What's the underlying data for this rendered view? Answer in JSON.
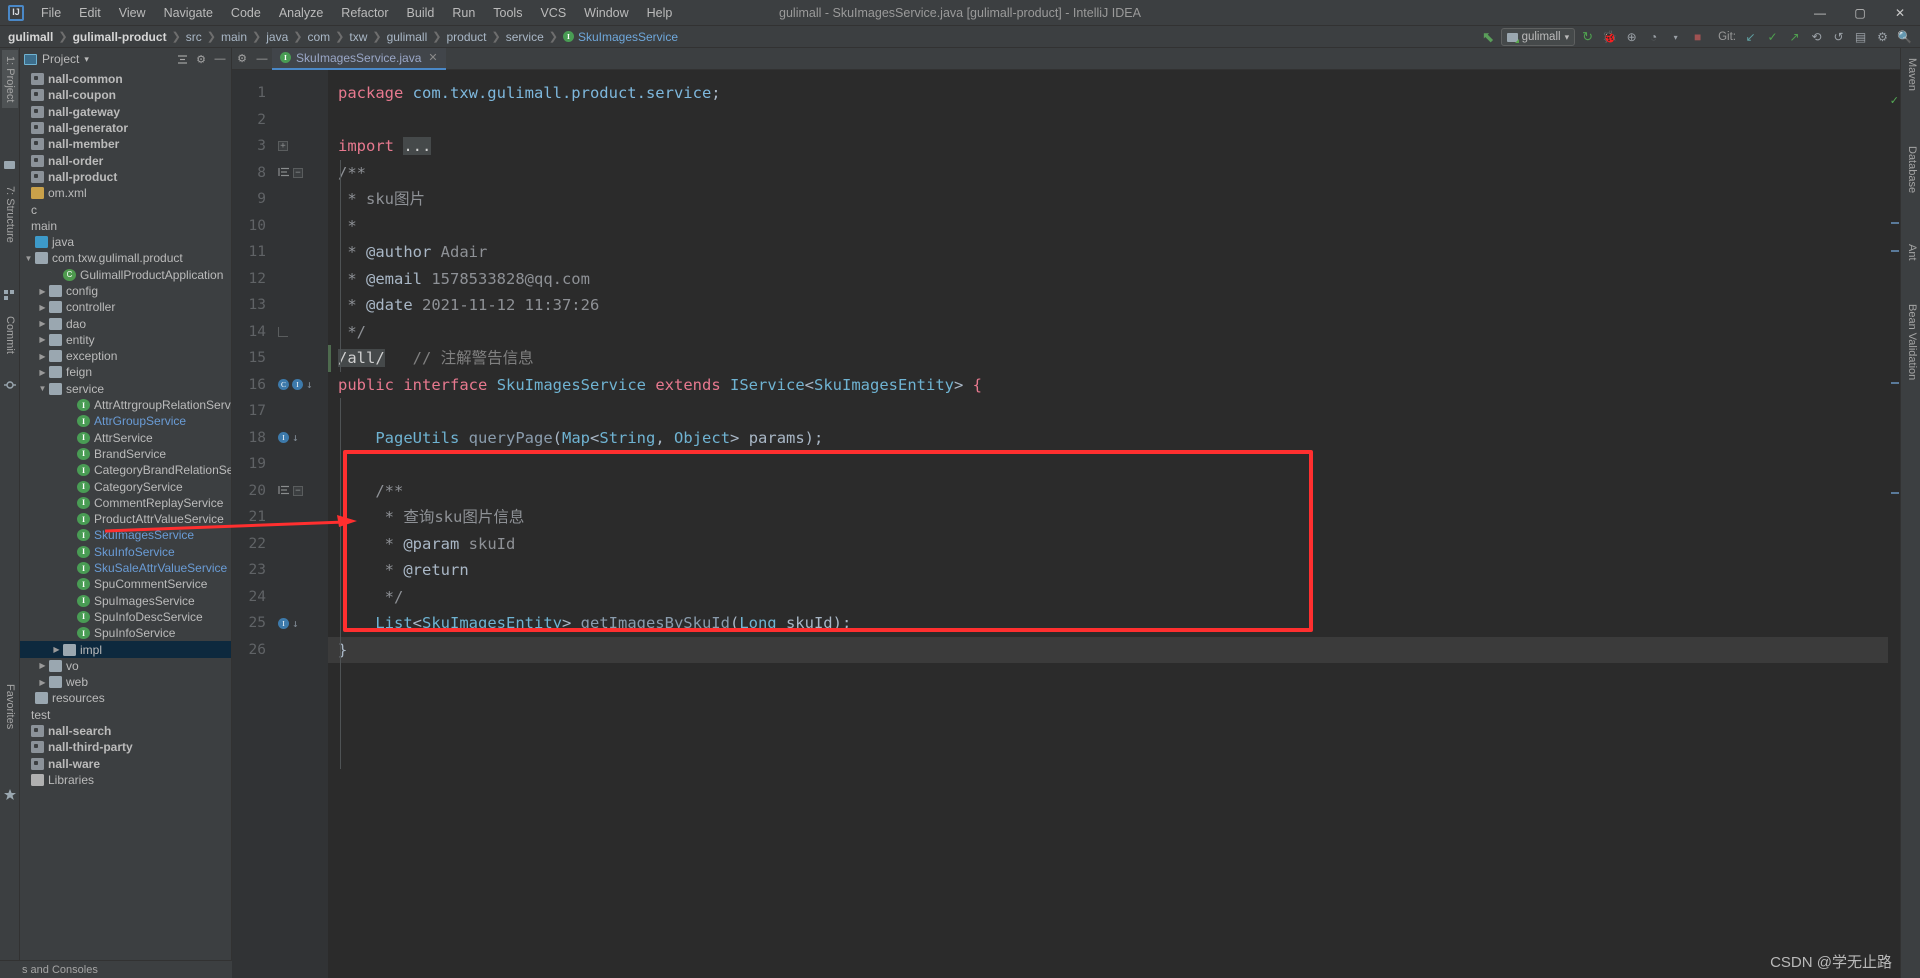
{
  "window": {
    "title": "gulimall - SkuImagesService.java [gulimall-product] - IntelliJ IDEA",
    "logo": "IJ",
    "minimize": "—",
    "maximize": "▢",
    "close": "✕"
  },
  "menu": [
    {
      "label": "File"
    },
    {
      "label": "Edit"
    },
    {
      "label": "View"
    },
    {
      "label": "Navigate"
    },
    {
      "label": "Code"
    },
    {
      "label": "Analyze"
    },
    {
      "label": "Refactor"
    },
    {
      "label": "Build"
    },
    {
      "label": "Run"
    },
    {
      "label": "Tools"
    },
    {
      "label": "VCS"
    },
    {
      "label": "Window"
    },
    {
      "label": "Help"
    }
  ],
  "breadcrumb": [
    {
      "label": "gulimall",
      "style": "bold"
    },
    {
      "label": "gulimall-product",
      "style": "bold"
    },
    {
      "label": "src",
      "style": "normal"
    },
    {
      "label": "main",
      "style": "normal"
    },
    {
      "label": "java",
      "style": "normal"
    },
    {
      "label": "com",
      "style": "normal"
    },
    {
      "label": "txw",
      "style": "normal"
    },
    {
      "label": "gulimall",
      "style": "normal"
    },
    {
      "label": "product",
      "style": "normal"
    },
    {
      "label": "service",
      "style": "normal"
    },
    {
      "label": "SkuImagesService",
      "style": "interface"
    }
  ],
  "toolbar": {
    "build_icon": "build-hammer-icon",
    "run_config": "gulimall",
    "dropdown_caret": "▾",
    "run_icon": "▶",
    "debug_icon": "debug-icon",
    "coverage_icon": "coverage-icon",
    "profiler_icon": "profiler-icon",
    "stop_icon": "■",
    "git_label": "Git:",
    "git_update": "↙",
    "git_commit": "✓",
    "git_push": "↗",
    "git_history": "⟲",
    "search_icon": "🔍",
    "layout_icon": "layout-icon",
    "settings_icon": "⚙",
    "avatar_icon": "avatar-icon"
  },
  "left_stripe": [
    {
      "label": "1: Project",
      "active": true
    },
    {
      "label": "7: Structure",
      "active": false
    },
    {
      "label": "Commit",
      "active": false
    },
    {
      "label": "Favorites",
      "active": false
    }
  ],
  "right_stripe": [
    {
      "label": "Maven"
    },
    {
      "label": "Database"
    },
    {
      "label": "Ant"
    },
    {
      "label": "Bean Validation"
    }
  ],
  "bottom_stripe": {
    "label": "s and Consoles"
  },
  "project_panel": {
    "title": "Project",
    "title_caret": "▾",
    "collapse_icon": "collapse-all-icon",
    "settings_icon": "⚙",
    "hide_icon": "—",
    "tree": [
      {
        "label": "nall-common",
        "indent": 0,
        "arrow": "",
        "icon": "mod",
        "color": "bold",
        "selected": false
      },
      {
        "label": "nall-coupon",
        "indent": 0,
        "arrow": "",
        "icon": "mod",
        "color": "bold",
        "selected": false
      },
      {
        "label": "nall-gateway",
        "indent": 0,
        "arrow": "",
        "icon": "mod",
        "color": "bold",
        "selected": false
      },
      {
        "label": "nall-generator",
        "indent": 0,
        "arrow": "",
        "icon": "mod",
        "color": "bold",
        "selected": false
      },
      {
        "label": "nall-member",
        "indent": 0,
        "arrow": "",
        "icon": "mod",
        "color": "bold",
        "selected": false
      },
      {
        "label": "nall-order",
        "indent": 0,
        "arrow": "",
        "icon": "mod",
        "color": "bold",
        "selected": false
      },
      {
        "label": "nall-product",
        "indent": 0,
        "arrow": "",
        "icon": "mod",
        "color": "bold",
        "selected": false
      },
      {
        "label": "om.xml",
        "indent": 0,
        "arrow": "",
        "icon": "xml",
        "color": "normal",
        "selected": false
      },
      {
        "label": "c",
        "indent": 0,
        "arrow": "",
        "icon": "none",
        "color": "normal",
        "selected": false
      },
      {
        "label": "main",
        "indent": 0,
        "arrow": "",
        "icon": "none",
        "color": "normal",
        "selected": false
      },
      {
        "label": "java",
        "indent": 1,
        "arrow": "",
        "icon": "src",
        "color": "normal",
        "selected": false
      },
      {
        "label": "com.txw.gulimall.product",
        "indent": 1,
        "arrow": "▼",
        "icon": "fld",
        "color": "normal",
        "selected": false
      },
      {
        "label": "GulimallProductApplication",
        "indent": 3,
        "arrow": "",
        "icon": "cls",
        "color": "normal",
        "selected": false
      },
      {
        "label": "config",
        "indent": 2,
        "arrow": "▶",
        "icon": "fld",
        "color": "normal",
        "selected": false
      },
      {
        "label": "controller",
        "indent": 2,
        "arrow": "▶",
        "icon": "fld",
        "color": "normal",
        "selected": false
      },
      {
        "label": "dao",
        "indent": 2,
        "arrow": "▶",
        "icon": "fld",
        "color": "normal",
        "selected": false
      },
      {
        "label": "entity",
        "indent": 2,
        "arrow": "▶",
        "icon": "fld",
        "color": "normal",
        "selected": false
      },
      {
        "label": "exception",
        "indent": 2,
        "arrow": "▶",
        "icon": "fld",
        "color": "normal",
        "selected": false
      },
      {
        "label": "feign",
        "indent": 2,
        "arrow": "▶",
        "icon": "fld",
        "color": "normal",
        "selected": false
      },
      {
        "label": "service",
        "indent": 2,
        "arrow": "▼",
        "icon": "fld",
        "color": "normal",
        "selected": false
      },
      {
        "label": "AttrAttrgroupRelationService",
        "indent": 4,
        "arrow": "",
        "icon": "iface",
        "color": "normal",
        "selected": false
      },
      {
        "label": "AttrGroupService",
        "indent": 4,
        "arrow": "",
        "icon": "iface",
        "color": "blue",
        "selected": false
      },
      {
        "label": "AttrService",
        "indent": 4,
        "arrow": "",
        "icon": "iface",
        "color": "normal",
        "selected": false
      },
      {
        "label": "BrandService",
        "indent": 4,
        "arrow": "",
        "icon": "iface",
        "color": "normal",
        "selected": false
      },
      {
        "label": "CategoryBrandRelationService",
        "indent": 4,
        "arrow": "",
        "icon": "iface",
        "color": "normal",
        "selected": false
      },
      {
        "label": "CategoryService",
        "indent": 4,
        "arrow": "",
        "icon": "iface",
        "color": "normal",
        "selected": false
      },
      {
        "label": "CommentReplayService",
        "indent": 4,
        "arrow": "",
        "icon": "iface",
        "color": "normal",
        "selected": false
      },
      {
        "label": "ProductAttrValueService",
        "indent": 4,
        "arrow": "",
        "icon": "iface",
        "color": "normal",
        "selected": false
      },
      {
        "label": "SkuImagesService",
        "indent": 4,
        "arrow": "",
        "icon": "iface",
        "color": "blue",
        "selected": false
      },
      {
        "label": "SkuInfoService",
        "indent": 4,
        "arrow": "",
        "icon": "iface",
        "color": "blue",
        "selected": false
      },
      {
        "label": "SkuSaleAttrValueService",
        "indent": 4,
        "arrow": "",
        "icon": "iface",
        "color": "blue",
        "selected": false
      },
      {
        "label": "SpuCommentService",
        "indent": 4,
        "arrow": "",
        "icon": "iface",
        "color": "normal",
        "selected": false
      },
      {
        "label": "SpuImagesService",
        "indent": 4,
        "arrow": "",
        "icon": "iface",
        "color": "normal",
        "selected": false
      },
      {
        "label": "SpuInfoDescService",
        "indent": 4,
        "arrow": "",
        "icon": "iface",
        "color": "normal",
        "selected": false
      },
      {
        "label": "SpuInfoService",
        "indent": 4,
        "arrow": "",
        "icon": "iface",
        "color": "normal",
        "selected": false
      },
      {
        "label": "impl",
        "indent": 3,
        "arrow": "▶",
        "icon": "fld",
        "color": "normal",
        "selected": true
      },
      {
        "label": "vo",
        "indent": 2,
        "arrow": "▶",
        "icon": "fld",
        "color": "normal",
        "selected": false
      },
      {
        "label": "web",
        "indent": 2,
        "arrow": "▶",
        "icon": "fld",
        "color": "normal",
        "selected": false
      },
      {
        "label": "resources",
        "indent": 1,
        "arrow": "",
        "icon": "fld",
        "color": "normal",
        "selected": false
      },
      {
        "label": "test",
        "indent": 0,
        "arrow": "",
        "icon": "none",
        "color": "normal",
        "selected": false
      },
      {
        "label": "nall-search",
        "indent": 0,
        "arrow": "",
        "icon": "mod",
        "color": "bold",
        "selected": false
      },
      {
        "label": "nall-third-party",
        "indent": 0,
        "arrow": "",
        "icon": "mod",
        "color": "bold",
        "selected": false
      },
      {
        "label": "nall-ware",
        "indent": 0,
        "arrow": "",
        "icon": "mod",
        "color": "bold",
        "selected": false
      },
      {
        "label": "Libraries",
        "indent": 0,
        "arrow": "",
        "icon": "lib",
        "color": "normal",
        "selected": false
      }
    ]
  },
  "editor": {
    "tab": {
      "label": "SkuImagesService.java",
      "icon": "interface-icon",
      "close": "✕"
    },
    "settings_icon": "⚙",
    "hide_icon": "—",
    "lines": [
      {
        "num": "1",
        "tokens": [
          {
            "t": "package ",
            "c": "kw2"
          },
          {
            "t": "com.txw.gulimall.product.service",
            "c": "pkg"
          },
          {
            "t": ";",
            "c": "plain"
          }
        ]
      },
      {
        "num": "2",
        "tokens": []
      },
      {
        "num": "3",
        "tokens": [
          {
            "t": "import ",
            "c": "kw2"
          },
          {
            "t": "...",
            "c": "hlbox"
          }
        ]
      },
      {
        "num": "8",
        "tokens": [
          {
            "t": "/**",
            "c": "doc"
          }
        ]
      },
      {
        "num": "9",
        "tokens": [
          {
            "t": " * sku图片",
            "c": "doc"
          }
        ]
      },
      {
        "num": "10",
        "tokens": [
          {
            "t": " *",
            "c": "doc"
          }
        ]
      },
      {
        "num": "11",
        "tokens": [
          {
            "t": " * ",
            "c": "doc"
          },
          {
            "t": "@author",
            "c": "plain"
          },
          {
            "t": " Adair",
            "c": "doc"
          }
        ]
      },
      {
        "num": "12",
        "tokens": [
          {
            "t": " * ",
            "c": "doc"
          },
          {
            "t": "@email",
            "c": "plain"
          },
          {
            "t": " 1578533828@qq.com",
            "c": "doc"
          }
        ]
      },
      {
        "num": "13",
        "tokens": [
          {
            "t": " * ",
            "c": "doc"
          },
          {
            "t": "@date",
            "c": "plain"
          },
          {
            "t": " 2021-11-12 11:37:26",
            "c": "doc"
          }
        ]
      },
      {
        "num": "14",
        "tokens": [
          {
            "t": " */",
            "c": "doc"
          }
        ]
      },
      {
        "num": "15",
        "tokens": [
          {
            "t": "/all/",
            "c": "hlbox"
          },
          {
            "t": "   ",
            "c": "plain"
          },
          {
            "t": "// 注解警告信息",
            "c": "cmt"
          }
        ]
      },
      {
        "num": "16",
        "tokens": [
          {
            "t": "public",
            "c": "kw2"
          },
          {
            "t": " ",
            "c": "plain"
          },
          {
            "t": "interface",
            "c": "kw2"
          },
          {
            "t": " ",
            "c": "plain"
          },
          {
            "t": "SkuImagesService",
            "c": "typ"
          },
          {
            "t": " ",
            "c": "plain"
          },
          {
            "t": "extends",
            "c": "kw2"
          },
          {
            "t": " ",
            "c": "plain"
          },
          {
            "t": "IService",
            "c": "typ"
          },
          {
            "t": "<",
            "c": "plain"
          },
          {
            "t": "SkuImagesEntity",
            "c": "typ"
          },
          {
            "t": "> ",
            "c": "plain"
          },
          {
            "t": "{",
            "c": "kw2"
          }
        ]
      },
      {
        "num": "17",
        "tokens": []
      },
      {
        "num": "18",
        "tokens": [
          {
            "t": "    ",
            "c": "plain"
          },
          {
            "t": "PageUtils",
            "c": "typ"
          },
          {
            "t": " ",
            "c": "plain"
          },
          {
            "t": "queryPage",
            "c": "fn"
          },
          {
            "t": "(",
            "c": "plain"
          },
          {
            "t": "Map",
            "c": "typ"
          },
          {
            "t": "<",
            "c": "plain"
          },
          {
            "t": "String",
            "c": "typ"
          },
          {
            "t": ", ",
            "c": "plain"
          },
          {
            "t": "Object",
            "c": "typ"
          },
          {
            "t": "> params);",
            "c": "plain"
          }
        ]
      },
      {
        "num": "19",
        "tokens": []
      },
      {
        "num": "20",
        "tokens": [
          {
            "t": "    /**",
            "c": "doc"
          }
        ]
      },
      {
        "num": "21",
        "tokens": [
          {
            "t": "     * 查询sku图片信息",
            "c": "doc"
          }
        ]
      },
      {
        "num": "22",
        "tokens": [
          {
            "t": "     * ",
            "c": "doc"
          },
          {
            "t": "@param",
            "c": "plain"
          },
          {
            "t": " skuId",
            "c": "doc"
          }
        ]
      },
      {
        "num": "23",
        "tokens": [
          {
            "t": "     * ",
            "c": "doc"
          },
          {
            "t": "@return",
            "c": "plain"
          }
        ]
      },
      {
        "num": "24",
        "tokens": [
          {
            "t": "     */",
            "c": "doc"
          }
        ]
      },
      {
        "num": "25",
        "tokens": [
          {
            "t": "    ",
            "c": "plain"
          },
          {
            "t": "List",
            "c": "typ"
          },
          {
            "t": "<",
            "c": "plain"
          },
          {
            "t": "SkuImagesEntity",
            "c": "typ"
          },
          {
            "t": "> ",
            "c": "plain"
          },
          {
            "t": "getImagesBySkuId",
            "c": "fn"
          },
          {
            "t": "(",
            "c": "plain"
          },
          {
            "t": "Long",
            "c": "typ"
          },
          {
            "t": " skuId);",
            "c": "plain"
          }
        ]
      },
      {
        "num": "26",
        "tokens": [
          {
            "t": "}",
            "c": "plain"
          }
        ]
      }
    ]
  },
  "annotations": {
    "box_color": "#ff2f2f",
    "arrow_color": "#ff2f2f",
    "box_note": "highlights-getImagesBySkuId-javadoc-and-method",
    "arrow_note": "points-from-SkuImagesService-tree-node-to-code-block"
  },
  "watermark": "CSDN @学无止路"
}
